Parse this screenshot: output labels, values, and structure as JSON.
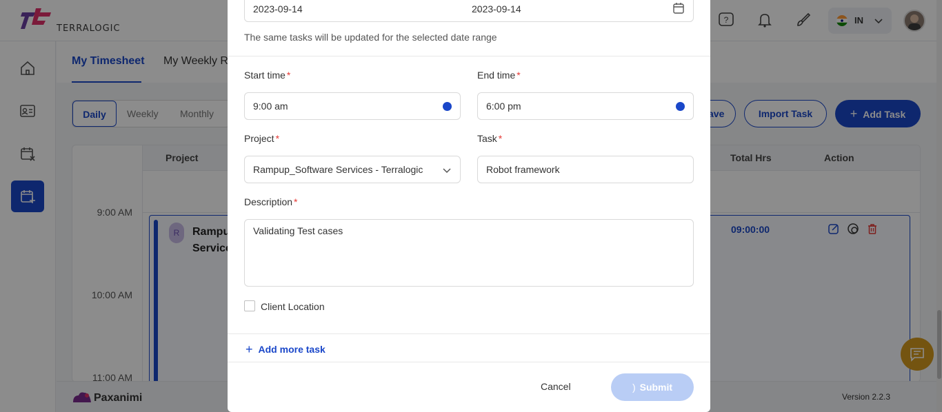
{
  "header": {
    "logo_text": "TERRALOGIC",
    "language_code": "IN"
  },
  "nav_tabs": [
    {
      "label": "My Timesheet"
    },
    {
      "label": "My Weekly Re"
    }
  ],
  "view_segments": [
    {
      "label": "Daily"
    },
    {
      "label": "Weekly"
    },
    {
      "label": "Monthly"
    }
  ],
  "toolbar": {
    "save_partial": "ave",
    "import_label": "Import Task",
    "add_label": "Add Task"
  },
  "grid": {
    "headers": {
      "project": "Project",
      "total_hrs": "Total Hrs",
      "action": "Action"
    },
    "time_labels": [
      "9:00 AM",
      "10:00 AM",
      "11:00 AM"
    ],
    "entry": {
      "avatar_letter": "R",
      "name": "Rampup_Software Services",
      "total": "09:00:00"
    }
  },
  "footer": {
    "brand": "Paxanimi",
    "version": "Version 2.2.3"
  },
  "modal": {
    "date_from": "2023-09-14",
    "date_to": "2023-09-14",
    "range_hint": "The same tasks will be updated for the selected date range",
    "start_time_label": "Start time",
    "start_time_value": "9:00 am",
    "end_time_label": "End time",
    "end_time_value": "6:00 pm",
    "project_label": "Project",
    "project_value": "Rampup_Software Services - Terralogic",
    "task_label": "Task",
    "task_value": "Robot framework",
    "description_label": "Description",
    "description_value": "Validating Test cases",
    "client_location_label": "Client Location",
    "add_more_label": "Add more task",
    "cancel_label": "Cancel",
    "submit_label": "Submit"
  },
  "colors": {
    "primary": "#1a47c9",
    "required": "#e53935",
    "submit_disabled": "#b9cdf5",
    "fab": "#d49a1e"
  }
}
